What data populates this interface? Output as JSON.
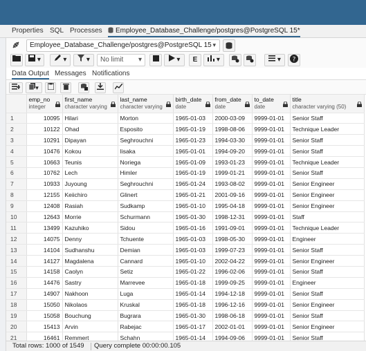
{
  "tabs": {
    "properties": "Properties",
    "sql": "SQL",
    "processes": "Processes",
    "query_tool": "Employee_Database_Challenge/postgres@PostgreSQL 15*"
  },
  "connection": {
    "value": "Employee_Database_Challenge/postgres@PostgreSQL 15"
  },
  "toolbar": {
    "limit": "No limit"
  },
  "subtabs": {
    "data_output": "Data Output",
    "messages": "Messages",
    "notifications": "Notifications"
  },
  "columns": [
    {
      "name": "emp_no",
      "type": "integer"
    },
    {
      "name": "first_name",
      "type": "character varying"
    },
    {
      "name": "last_name",
      "type": "character varying"
    },
    {
      "name": "birth_date",
      "type": "date"
    },
    {
      "name": "from_date",
      "type": "date"
    },
    {
      "name": "to_date",
      "type": "date"
    },
    {
      "name": "title",
      "type": "character varying (50)"
    }
  ],
  "rows": [
    [
      "1",
      "10095",
      "Hilari",
      "Morton",
      "1965-01-03",
      "2000-03-09",
      "9999-01-01",
      "Senior Staff"
    ],
    [
      "2",
      "10122",
      "Ohad",
      "Esposito",
      "1965-01-19",
      "1998-08-06",
      "9999-01-01",
      "Technique Leader"
    ],
    [
      "3",
      "10291",
      "Dipayan",
      "Seghrouchni",
      "1965-01-23",
      "1994-03-30",
      "9999-01-01",
      "Senior Staff"
    ],
    [
      "4",
      "10476",
      "Kokou",
      "Iisaka",
      "1965-01-01",
      "1994-09-20",
      "9999-01-01",
      "Senior Staff"
    ],
    [
      "5",
      "10663",
      "Teunis",
      "Noriega",
      "1965-01-09",
      "1993-01-23",
      "9999-01-01",
      "Technique Leader"
    ],
    [
      "6",
      "10762",
      "Lech",
      "Himler",
      "1965-01-19",
      "1999-01-21",
      "9999-01-01",
      "Senior Staff"
    ],
    [
      "7",
      "10933",
      "Juyoung",
      "Seghrouchni",
      "1965-01-24",
      "1993-08-02",
      "9999-01-01",
      "Senior Engineer"
    ],
    [
      "8",
      "12155",
      "Keiichiro",
      "Glinert",
      "1965-01-21",
      "2001-09-16",
      "9999-01-01",
      "Senior Engineer"
    ],
    [
      "9",
      "12408",
      "Rasiah",
      "Sudkamp",
      "1965-01-10",
      "1995-04-18",
      "9999-01-01",
      "Senior Engineer"
    ],
    [
      "10",
      "12643",
      "Morrie",
      "Schurmann",
      "1965-01-30",
      "1998-12-31",
      "9999-01-01",
      "Staff"
    ],
    [
      "11",
      "13499",
      "Kazuhiko",
      "Sidou",
      "1965-01-16",
      "1991-09-01",
      "9999-01-01",
      "Technique Leader"
    ],
    [
      "12",
      "14075",
      "Denny",
      "Tchuente",
      "1965-01-03",
      "1998-05-30",
      "9999-01-01",
      "Engineer"
    ],
    [
      "13",
      "14104",
      "Sudhanshu",
      "Demian",
      "1965-01-03",
      "1999-07-23",
      "9999-01-01",
      "Senior Staff"
    ],
    [
      "14",
      "14127",
      "Magdalena",
      "Cannard",
      "1965-01-10",
      "2002-04-22",
      "9999-01-01",
      "Senior Engineer"
    ],
    [
      "15",
      "14158",
      "Caolyn",
      "Setiz",
      "1965-01-22",
      "1996-02-06",
      "9999-01-01",
      "Senior Staff"
    ],
    [
      "16",
      "14476",
      "Sastry",
      "Marrevee",
      "1965-01-18",
      "1999-09-25",
      "9999-01-01",
      "Engineer"
    ],
    [
      "17",
      "14907",
      "Nakhoon",
      "Luga",
      "1965-01-14",
      "1994-12-18",
      "9999-01-01",
      "Senior Staff"
    ],
    [
      "18",
      "15050",
      "Nikolaos",
      "Kruskal",
      "1965-01-18",
      "1996-12-16",
      "9999-01-01",
      "Senior Engineer"
    ],
    [
      "19",
      "15058",
      "Bouchung",
      "Bugrara",
      "1965-01-30",
      "1998-06-18",
      "9999-01-01",
      "Senior Staff"
    ],
    [
      "20",
      "15413",
      "Arvin",
      "Rabejac",
      "1965-01-17",
      "2002-01-01",
      "9999-01-01",
      "Senior Engineer"
    ],
    [
      "21",
      "16461",
      "Remmert",
      "Schahn",
      "1965-01-14",
      "1994-09-06",
      "9999-01-01",
      "Senior Staff"
    ]
  ],
  "status": {
    "total_rows": "Total rows: 1000 of 1549",
    "query_complete": "Query complete 00:00:00.105"
  },
  "colors": {
    "header_blue": "#326690",
    "grid_border": "#e0e0e0"
  }
}
